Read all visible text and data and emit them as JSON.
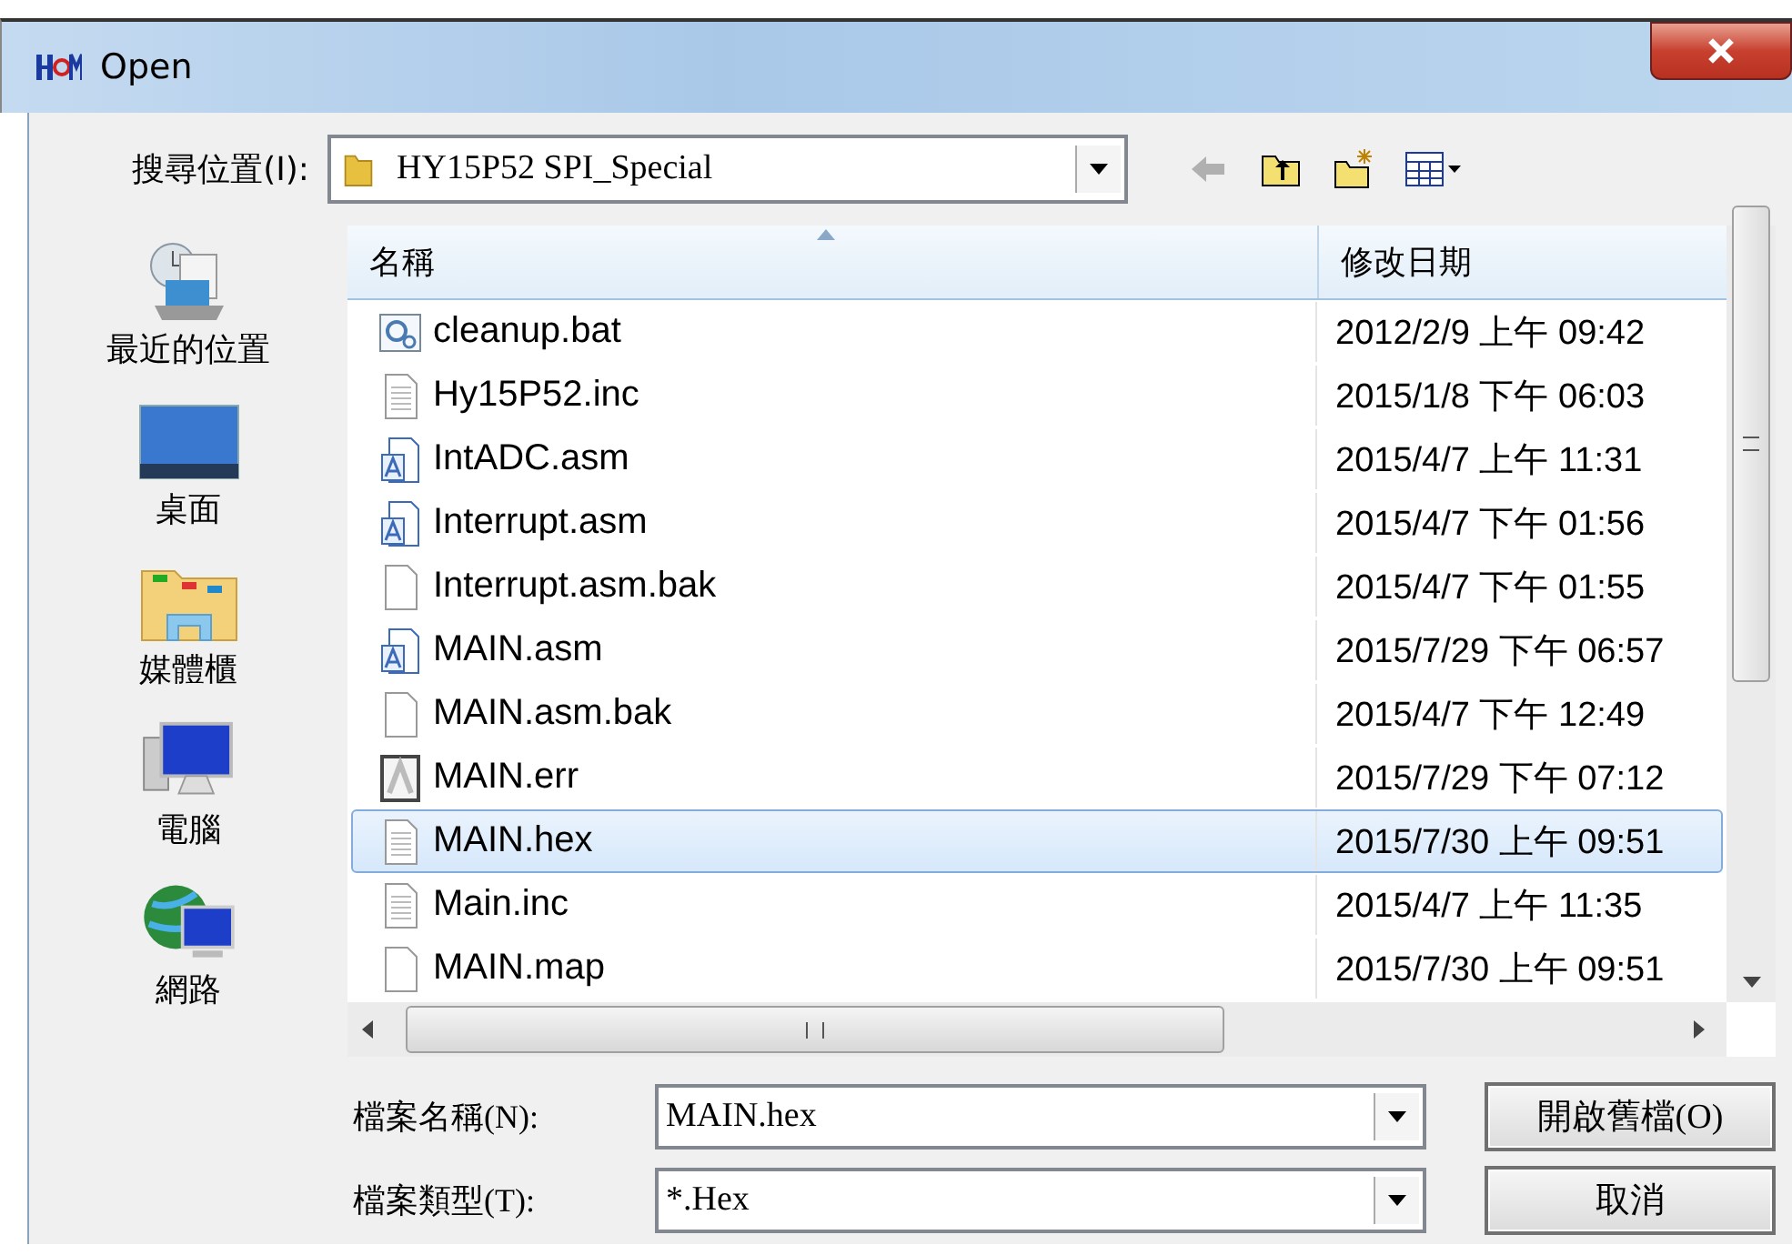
{
  "window": {
    "title": "Open"
  },
  "look_in": {
    "label": "搜尋位置(I):",
    "value": "HY15P52 SPI_Special"
  },
  "places": [
    {
      "label": "最近的位置",
      "kind": "recent"
    },
    {
      "label": "桌面",
      "kind": "desktop"
    },
    {
      "label": "媒體櫃",
      "kind": "library"
    },
    {
      "label": "電腦",
      "kind": "computer"
    },
    {
      "label": "網路",
      "kind": "network"
    }
  ],
  "file_list": {
    "columns": [
      "名稱",
      "修改日期"
    ],
    "rows": [
      {
        "name": "cleanup.bat",
        "date": "2012/2/9 上午 09:42",
        "kind": "script",
        "selected": false
      },
      {
        "name": "Hy15P52.inc",
        "date": "2015/1/8 下午 06:03",
        "kind": "text",
        "selected": false
      },
      {
        "name": "IntADC.asm",
        "date": "2015/4/7 上午 11:31",
        "kind": "asm",
        "selected": false
      },
      {
        "name": "Interrupt.asm",
        "date": "2015/4/7 下午 01:56",
        "kind": "asm",
        "selected": false
      },
      {
        "name": "Interrupt.asm.bak",
        "date": "2015/4/7 下午 01:55",
        "kind": "blank",
        "selected": false
      },
      {
        "name": "MAIN.asm",
        "date": "2015/7/29 下午 06:57",
        "kind": "asm",
        "selected": false
      },
      {
        "name": "MAIN.asm.bak",
        "date": "2015/4/7 下午 12:49",
        "kind": "blank",
        "selected": false
      },
      {
        "name": "MAIN.err",
        "date": "2015/7/29 下午 07:12",
        "kind": "error",
        "selected": false
      },
      {
        "name": "MAIN.hex",
        "date": "2015/7/30 上午 09:51",
        "kind": "text",
        "selected": true
      },
      {
        "name": "Main.inc",
        "date": "2015/4/7 上午 11:35",
        "kind": "text",
        "selected": false
      },
      {
        "name": "MAIN.map",
        "date": "2015/7/30 上午 09:51",
        "kind": "blank",
        "selected": false
      }
    ]
  },
  "file_name": {
    "label": "檔案名稱(N):",
    "value": "MAIN.hex"
  },
  "file_type": {
    "label": "檔案類型(T):",
    "value": "*.Hex"
  },
  "buttons": [
    "開啟舊檔(O)",
    "取消"
  ]
}
